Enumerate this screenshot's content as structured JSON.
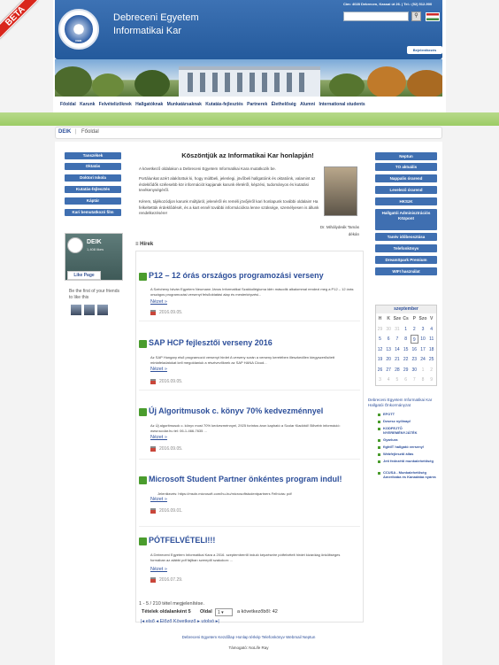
{
  "badge": "BETA",
  "header": {
    "title_line1": "Debreceni Egyetem",
    "title_line2": "Informatikai Kar",
    "contact": "Cím: 4028 Debrecen, Kassai út 26. | Tel.: (52) 512-900",
    "login": "Bejelentkezés"
  },
  "nav": [
    "Főoldal",
    "Karunk",
    "Felvételizőknek",
    "Hallgatóknak",
    "Munkatársaknak",
    "Kutatás-fejlesztés",
    "Partnerek",
    "Élethelőség",
    "Alumni",
    "International students"
  ],
  "breadcrumb": {
    "home": "DEIK",
    "sep": "|",
    "current": "Főoldal"
  },
  "left_menu": [
    "Tanszékek",
    "Oktatás",
    "Doktori Iskola",
    "Kutatás-fejlesztés",
    "Káptár",
    "Kari bemutatkozó film"
  ],
  "facebook": {
    "name": "DEIK",
    "likes": "1,408 likes",
    "like_label": "Like Page",
    "first": "Be the first of your friends to like this"
  },
  "welcome": {
    "title": "Köszöntjük az Informatikai Kar honlapján!",
    "p1": "A következő oldalakon a Debreceni Egyetem Informatikai Kara mutatkozik be.",
    "p2": "Portálunkat azért alakítottuk ki, hogy múltbeli, jelenlegi, jövőbeli hallgatóink és oktatóink, valamint az érdeklődők szélesebb kör információt kapjanak karunk életéről, képzési, tudományos és kutatási tevékenységéről.",
    "p3": "Kérem, tájékozódjon karunk múltjáról, jelenéről és reméli jövőjéről kari honlapunk további oldalain! Ha felkeltettük érdeklődését, és a kart ennél további információkra lenne szüksége, személyesen is állunk rendelkezésére!",
    "sig_name": "Dr. Mihálydeák Tamás",
    "sig_role": "dékán"
  },
  "news_heading": "Hírek",
  "news": [
    {
      "title": "P12 – 12 órás országos programozási verseny",
      "body": "A Szécheny István Egyetem Neumann János Informatikai Szakkollégiuma idén második alkalommal rendezi meg a P12 – 12 órás országos programozási versenyt felsőoktatási alap és mesterképzési...",
      "more": "Nézet »",
      "date": "2016.09.05."
    },
    {
      "title": "SAP HCP fejlesztői verseny 2016",
      "body": "Az SAP Hungary első programozói versenyt hirdet A verseny során a verseny keretében illeszkedően kiegyszerűsített mintafeladatokat kell megoldaniuk a résztvevőknek az SAP HANA Cloud...",
      "more": "Nézet »",
      "date": "2016.09.05."
    },
    {
      "title": "Új Algoritmusok c. könyv 70% kedvezménnyel",
      "body": "Az Új algoritmusok c. könyv most 70% kedvezménnyel, 2925 forintos áron kapható a Scolar Kiadótól! Bővebb információ: www.scolar.hu tel: 06-1-466-7635 ...",
      "more": "Nézet »",
      "date": "2016.09.05."
    },
    {
      "title": "Microsoft Student Partner önkéntes program indul!",
      "body": "Jelentkezés: https://msdn.microsoft.com/hu-hu/microsoftstudentpartners Felhívás: pdf",
      "more": "Nézet »",
      "date": "2016.09.01."
    },
    {
      "title": "PÓTFELVÉTELI!!!",
      "body": "A Debreceni Egyetem Informatikai Kara a 2016. szeptemberről induló képzéseire pótfelvételt hirdet kizárólag önköltséges formában az alábbi pdf fájlban szereplő szakokon: ...",
      "more": "Nézet »",
      "date": "2016.07.29."
    }
  ],
  "pagination": {
    "count": "1 - 5 / 210 tétel megjelenítése.",
    "per_label": "Tételek oldalanként 5",
    "page_label": "Oldal",
    "page_value": "1",
    "page_of": "a következőből: 42",
    "nav": "|◂ első   ◂ Előző   Következő ▸   utolsó ▸|"
  },
  "right_menu": [
    "Neptun",
    "TO aktuális",
    "Nappalis órarend",
    "Levelező órarend",
    "HKSzK",
    "Hallgatói Adminisztrációs Központ",
    "Tanév időbeosztása",
    "Telefonkönyv",
    "DreamSpark Premium",
    "WIFI használat"
  ],
  "calendar": {
    "month": "szeptember",
    "weekdays": [
      "H",
      "K",
      "Sze",
      "Cs",
      "P",
      "Szo",
      "V"
    ],
    "weeks": [
      [
        "29",
        "30",
        "31",
        "1",
        "2",
        "3",
        "4"
      ],
      [
        "5",
        "6",
        "7",
        "8",
        "9",
        "10",
        "11"
      ],
      [
        "12",
        "13",
        "14",
        "15",
        "16",
        "17",
        "18"
      ],
      [
        "19",
        "20",
        "21",
        "22",
        "23",
        "24",
        "25"
      ],
      [
        "26",
        "27",
        "28",
        "29",
        "30",
        "1",
        "2"
      ],
      [
        "3",
        "4",
        "5",
        "6",
        "7",
        "8",
        "9"
      ]
    ]
  },
  "links_head": "Debreceni Egyetem Informatikai Kar Hallgatói Önkormányzat",
  "links": [
    "EFOTT",
    "Dzsesz nyílinap!",
    "KODFEJTŐ NYEREMÉNYJÁTÉK",
    "Gyarlura",
    "fightIT hallgató verseny!",
    "Webfejlesztő állás",
    "Jeti fedezétő munkalehetőség",
    "CCUSA - Munkalehetőség Amerikába és Kanadába nyárra"
  ],
  "footer": {
    "links": "Debreceni Egyetem Kezdőlap Honlap térkép Telefonkönyv Webmail Neptun",
    "sponsor": "Támogató: NoLife Ray"
  }
}
